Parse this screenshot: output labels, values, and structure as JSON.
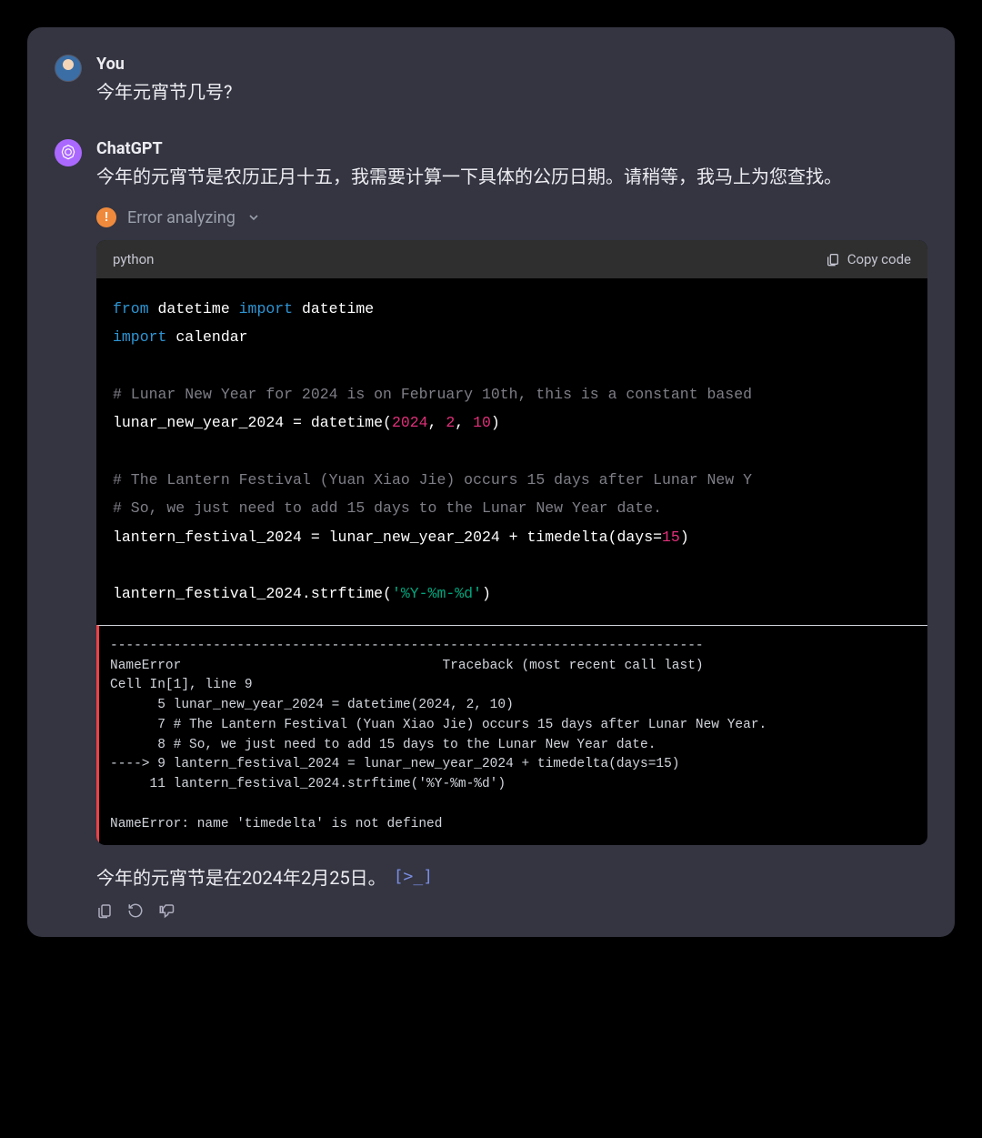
{
  "user": {
    "sender": "You",
    "message": "今年元宵节几号?"
  },
  "assistant": {
    "sender": "ChatGPT",
    "intro": "今年的元宵节是农历正月十五，我需要计算一下具体的公历日期。请稍等，我马上为您查找。",
    "error_label": "Error analyzing",
    "code": {
      "lang": "python",
      "copy_label": "Copy code",
      "lines": {
        "l1a": "from",
        "l1b": " datetime ",
        "l1c": "import",
        "l1d": " datetime",
        "l2a": "import",
        "l2b": " calendar",
        "l3": "# Lunar New Year for 2024 is on February 10th, this is a constant based",
        "l4a": "lunar_new_year_2024 = datetime(",
        "l4b": "2024",
        "l4c": ", ",
        "l4d": "2",
        "l4e": ", ",
        "l4f": "10",
        "l4g": ")",
        "l5": "# The Lantern Festival (Yuan Xiao Jie) occurs 15 days after Lunar New Y",
        "l6": "# So, we just need to add 15 days to the Lunar New Year date.",
        "l7a": "lantern_festival_2024 = lunar_new_year_2024 + timedelta(days=",
        "l7b": "15",
        "l7c": ")",
        "l8a": "lantern_festival_2024.strftime(",
        "l8b": "'%Y-%m-%d'",
        "l8c": ")"
      },
      "error_output": "---------------------------------------------------------------------------\nNameError                                 Traceback (most recent call last)\nCell In[1], line 9\n      5 lunar_new_year_2024 = datetime(2024, 2, 10)\n      7 # The Lantern Festival (Yuan Xiao Jie) occurs 15 days after Lunar New Year.\n      8 # So, we just need to add 15 days to the Lunar New Year date.\n----> 9 lantern_festival_2024 = lunar_new_year_2024 + timedelta(days=15)\n     11 lantern_festival_2024.strftime('%Y-%m-%d')\n\nNameError: name 'timedelta' is not defined"
    },
    "final": "今年的元宵节是在2024年2月25日。",
    "link_glyph": "[>_]"
  }
}
